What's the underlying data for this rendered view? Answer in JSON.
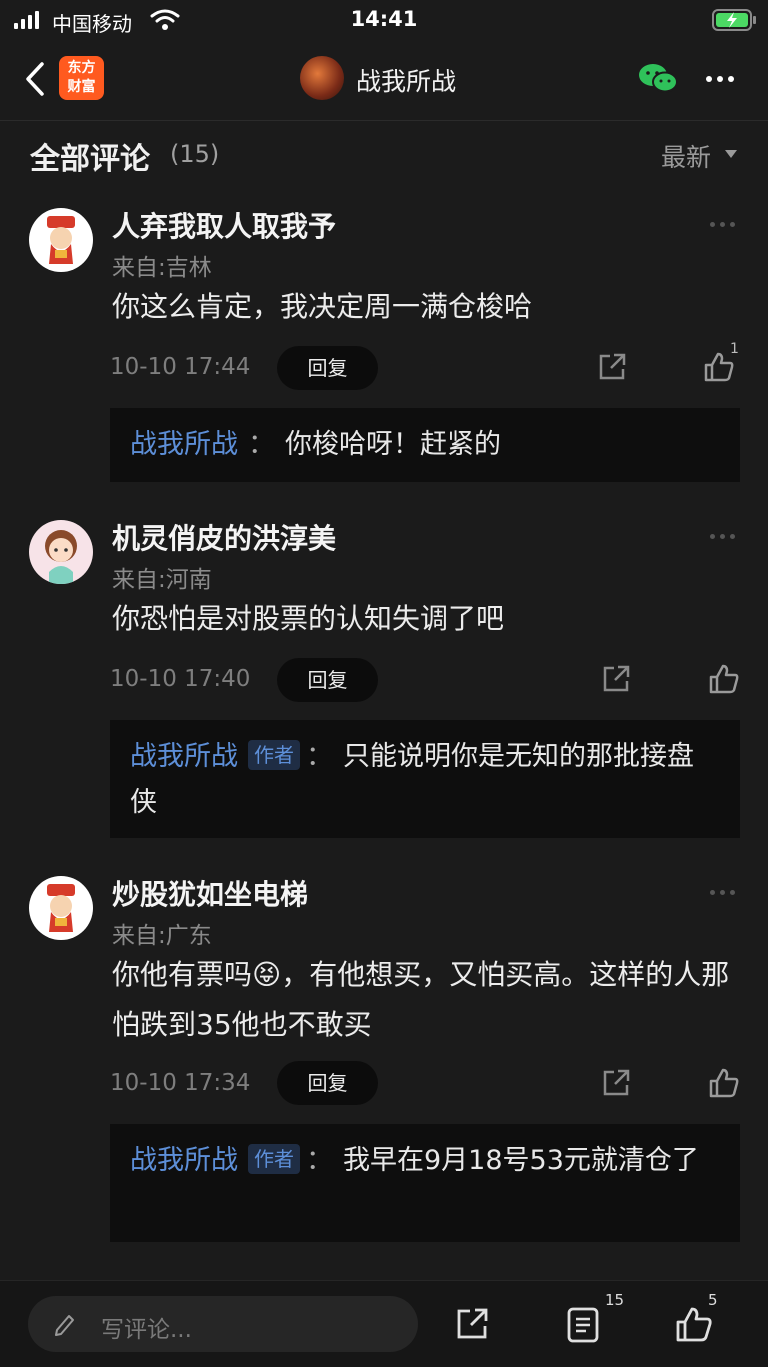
{
  "status": {
    "carrier": "中国移动",
    "time": "14:41"
  },
  "nav": {
    "logo_line1": "东方",
    "logo_line2": "财富",
    "title": "战我所战"
  },
  "section": {
    "title": "全部评论",
    "count": "(15)",
    "sort_label": "最新"
  },
  "comments": [
    {
      "user": "人弃我取人取我予",
      "location": "来自:吉林",
      "text": "你这么肯定，我决定周一满仓梭哈",
      "time": "10-10 17:44",
      "reply_label": "回复",
      "likes": "1",
      "reply": {
        "name": "战我所战",
        "tag": "",
        "colon": "：",
        "text": "你梭哈呀！赶紧的"
      }
    },
    {
      "user": "机灵俏皮的洪淳美",
      "location": "来自:河南",
      "text": "你恐怕是对股票的认知失调了吧",
      "time": "10-10 17:40",
      "reply_label": "回复",
      "likes": "",
      "reply": {
        "name": "战我所战",
        "tag": "作者",
        "colon": "：",
        "text": "只能说明你是无知的那批接盘侠"
      }
    },
    {
      "user": "炒股犹如坐电梯",
      "location": "来自:广东",
      "text": "你他有票吗😝，有他想买，又怕买高。这样的人那怕跌到35他也不敢买",
      "time": "10-10 17:34",
      "reply_label": "回复",
      "likes": "",
      "reply": {
        "name": "战我所战",
        "tag": "作者",
        "colon": "：",
        "text": "我早在9月18号53元就清仓了"
      }
    }
  ],
  "bottom": {
    "input_placeholder": "写评论...",
    "comment_count": "15",
    "like_count": "5"
  }
}
